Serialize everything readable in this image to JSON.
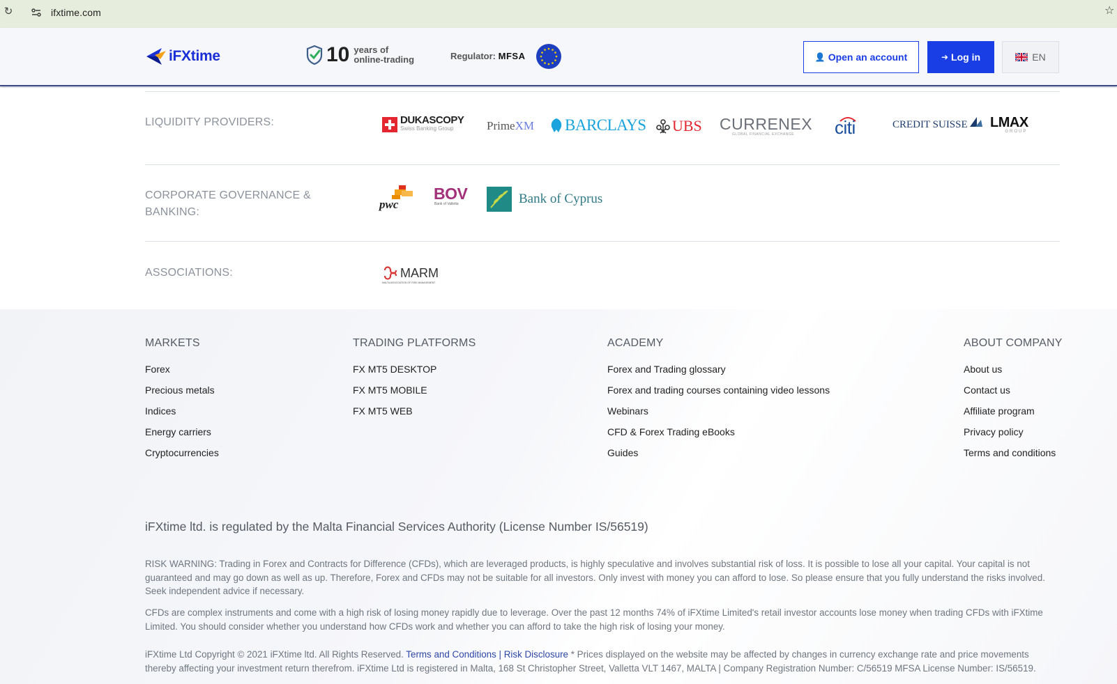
{
  "browser": {
    "url": "ifxtime.com"
  },
  "header": {
    "logo_text": "iFXtime",
    "years_number": "10",
    "years_line1": "years of",
    "years_line2": "online-trading",
    "regulator_label": "Regulator:",
    "regulator_value": "MFSA",
    "open_account_label": "Open an account",
    "login_label": "Log in",
    "lang_label": "EN"
  },
  "partners": {
    "liquidity_label": "LIQUIDITY PROVIDERS:",
    "governance_label_line1": "CORPORATE GOVERNANCE &",
    "governance_label_line2": "BANKING:",
    "associations_label": "ASSOCIATIONS:",
    "liquidity_logos": {
      "dukascopy": "DUKASCOPY",
      "dukascopy_sub": "Swiss Banking Group",
      "primexm_a": "Prime",
      "primexm_b": "XM",
      "barclays": "BARCLAYS",
      "ubs": "UBS",
      "currenex": "CURRENEX",
      "currenex_sub": "GLOBAL FINANCIAL EXCHANGE",
      "citi": "citi",
      "creditsuisse": "CREDIT SUISSE",
      "lmax": "LMAX",
      "lmax_sub": "GROUP"
    },
    "governance_logos": {
      "pwc": "pwc",
      "bov": "BOV",
      "bov_sub": "Bank of Valletta",
      "boc": "Bank of Cyprus"
    },
    "association_logos": {
      "marm": "MARM",
      "marm_sub": "MALTA ASSOCIATION OF RISK MANAGEMENT"
    }
  },
  "footer": {
    "markets": {
      "title": "MARKETS",
      "links": [
        "Forex",
        "Precious metals",
        "Indices",
        "Energy carriers",
        "Cryptocurrencies"
      ]
    },
    "platforms": {
      "title": "TRADING PLATFORMS",
      "links": [
        "FX MT5 DESKTOP",
        "FX MT5 MOBILE",
        "FX MT5 WEB"
      ]
    },
    "academy": {
      "title": "ACADEMY",
      "links": [
        "Forex and Trading glossary",
        "Forex and trading courses containing video lessons",
        "Webinars",
        "CFD & Forex Trading eBooks",
        "Guides"
      ]
    },
    "about": {
      "title": "ABOUT COMPANY",
      "links": [
        "About us",
        "Contact us",
        "Affiliate program",
        "Privacy policy",
        "Terms and conditions"
      ]
    },
    "regulated_line": "iFXtime ltd. is regulated by the Malta Financial Services Authority (License Number IS/56519)",
    "risk_warning": "RISK WARNING: Trading in Forex and Contracts for Difference (CFDs), which are leveraged products, is highly speculative and involves substantial risk of loss. It is possible to lose all your capital. Your capital is not guaranteed and may go down as well as up. Therefore, Forex and CFDs may not be suitable for all investors. Only invest with money you can afford to lose. So please ensure that you fully understand the risks involved. Seek independent advice if necessary.",
    "cfd_warning": "CFDs are complex instruments and come with a high risk of losing money rapidly due to leverage. Over the past 12 months 74% of iFXtime Limited's retail investor accounts lose money when trading CFDs with iFXtime Limited. You should consider whether you understand how CFDs work and whether you can afford to take the high risk of losing your money.",
    "copyright_start": "iFXtime Ltd Copyright © 2021 iFXtime ltd. All Rights Reserved. ",
    "terms_link": "Terms and Conditions",
    "separator": " | ",
    "risk_link": "Risk Disclosure",
    "copyright_end": " * Prices displayed on the website may be affected by changes in currency exchange rate and price movements thereby affecting your investment return therefrom. iFXtime Ltd is registered in Malta, 168 St Christopher Street, Valletta VLT 1467, MALTA | Company Registration Number: C/56519 MFSA License Number: IS/56519."
  },
  "colors": {
    "brand_blue": "#1a3ee6",
    "header_border": "#3d4a83",
    "browser_bar": "#e6eddc"
  }
}
